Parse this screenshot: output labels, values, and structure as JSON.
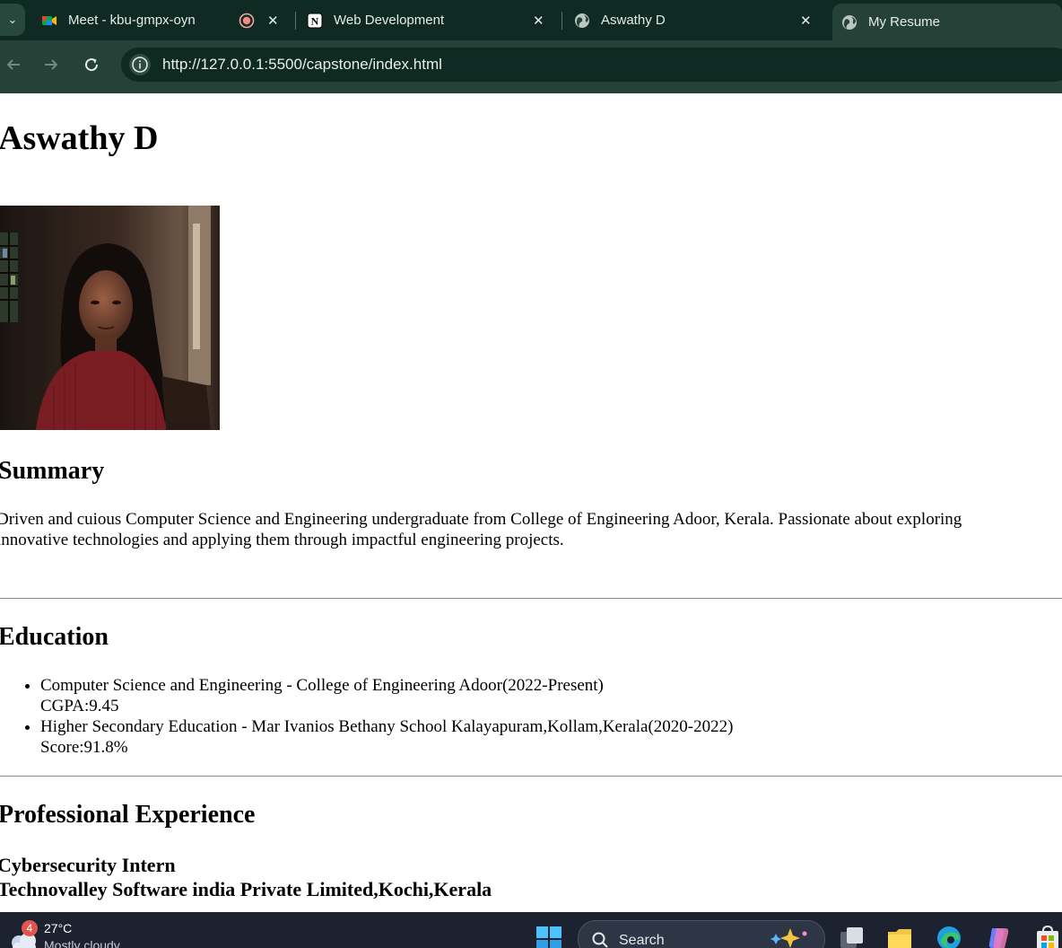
{
  "browser": {
    "tabs": [
      {
        "title": "Meet - kbu-gmpx-oyn",
        "favicon": "google-meet-icon",
        "recording": true,
        "active": false
      },
      {
        "title": "Web Development",
        "favicon": "notion-icon",
        "active": false
      },
      {
        "title": "Aswathy D",
        "favicon": "globe-icon",
        "active": false
      },
      {
        "title": "My Resume",
        "favicon": "globe-icon",
        "active": true
      }
    ],
    "url": "http://127.0.0.1:5500/capstone/index.html"
  },
  "page": {
    "name": "Aswathy D",
    "photo_alt": "profile-photo",
    "summary": {
      "heading": "Summary",
      "text": "Driven and cuious Computer Science and Engineering undergraduate from College of Engineering Adoor, Kerala. Passionate about exploring innovative technologies and applying them through impactful engineering projects."
    },
    "education": {
      "heading": "Education",
      "items": [
        {
          "title": "Computer Science and Engineering - College of Engineering Adoor(2022-Present)",
          "detail": "CGPA:9.45"
        },
        {
          "title": "Higher Secondary Education - Mar Ivanios Bethany School Kalayapuram,Kollam,Kerala(2020-2022)",
          "detail": "Score:91.8%"
        }
      ]
    },
    "experience": {
      "heading": "Professional Experience",
      "role": "Cybersecurity Intern",
      "company": "Technovalley Software india Private Limited,Kochi,Kerala"
    }
  },
  "taskbar": {
    "weather": {
      "notification_count": "4",
      "temperature": "27°C",
      "condition": "Mostly cloudy"
    },
    "search_placeholder": "Search"
  },
  "colors": {
    "chrome_dark": "#0e2a22",
    "chrome_mid": "#264238",
    "taskbar": "#1c2230"
  }
}
